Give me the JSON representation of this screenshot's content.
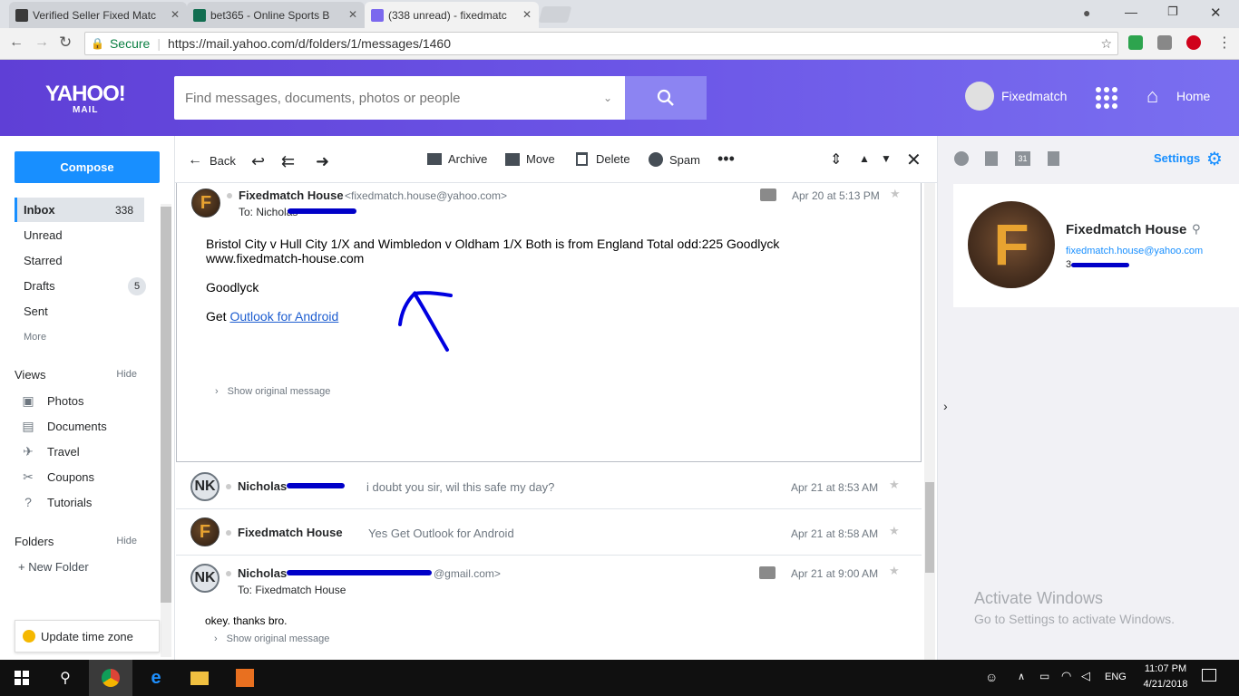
{
  "browser": {
    "tabs": [
      {
        "label": "Verified Seller Fixed Matc",
        "active": false
      },
      {
        "label": "bet365 - Online Sports B",
        "active": false
      },
      {
        "label": "(338 unread) - fixedmatc",
        "active": true
      }
    ],
    "secure_label": "Secure",
    "url": "https://mail.yahoo.com/d/folders/1/messages/1460"
  },
  "header": {
    "logo_text": "YAHOO!",
    "logo_sub": "MAIL",
    "search_placeholder": "Find messages, documents, photos or people",
    "user_name": "Fixedmatch",
    "home_label": "Home"
  },
  "sidebar": {
    "compose_label": "Compose",
    "folders": [
      {
        "label": "Inbox",
        "count": "338",
        "active": true
      },
      {
        "label": "Unread",
        "count": "",
        "active": false
      },
      {
        "label": "Starred",
        "count": "",
        "active": false
      },
      {
        "label": "Drafts",
        "count": "5",
        "active": false
      },
      {
        "label": "Sent",
        "count": "",
        "active": false
      }
    ],
    "more_label": "More",
    "views_label": "Views",
    "views_hide": "Hide",
    "views": [
      {
        "label": "Photos",
        "icon": "photos-icon"
      },
      {
        "label": "Documents",
        "icon": "documents-icon"
      },
      {
        "label": "Travel",
        "icon": "travel-icon"
      },
      {
        "label": "Coupons",
        "icon": "coupons-icon"
      },
      {
        "label": "Tutorials",
        "icon": "tutorials-icon"
      }
    ],
    "folders_label": "Folders",
    "folders_hide": "Hide",
    "new_folder": "+ New Folder",
    "update_tz": "Update time zone"
  },
  "toolbar": {
    "back": "Back",
    "archive": "Archive",
    "move": "Move",
    "delete": "Delete",
    "spam": "Spam"
  },
  "thread": {
    "first": {
      "avatar_letter": "F",
      "sender": "Fixedmatch House",
      "email": "<fixedmatch.house@yahoo.com>",
      "to": "To: Nicholas",
      "date": "Apr 20 at 5:13 PM",
      "body_line1": "Bristol City v Hull City 1/X and Wimbledon v Oldham 1/X Both is from England Total odd:225 Goodlyck",
      "body_line2": "www.fixedmatch-house.com",
      "body_line3": "Goodlyck",
      "body_get": "Get ",
      "body_link": "Outlook for Android",
      "show_original": "Show original message"
    },
    "rows": [
      {
        "avatar": "NK",
        "sender": "Nicholas",
        "snippet": "i doubt you sir, wil this safe my day?",
        "date": "Apr 21 at 8:53 AM"
      },
      {
        "avatar": "F",
        "sender": "Fixedmatch House",
        "snippet": "Yes Get Outlook for Android",
        "date": "Apr 21 at 8:58 AM"
      }
    ],
    "last": {
      "avatar": "NK",
      "sender": "Nicholas",
      "email_tail": "@gmail.com>",
      "to": "To: Fixedmatch House",
      "date": "Apr 21 at 9:00 AM",
      "body": "okey. thanks bro.",
      "show_original": "Show original message"
    }
  },
  "right_pane": {
    "settings_label": "Settings",
    "contact_name": "Fixedmatch House",
    "contact_email": "fixedmatch.house@yahoo.com",
    "contact_phone_prefix": "3"
  },
  "watermark": {
    "line1": "Activate Windows",
    "line2": "Go to Settings to activate Windows."
  },
  "taskbar": {
    "lang": "ENG",
    "time": "11:07 PM",
    "date": "4/21/2018"
  },
  "colors": {
    "header_gradient_start": "#5f3fd6",
    "compose_blue": "#188fff",
    "link_blue": "#1d5dd0"
  }
}
